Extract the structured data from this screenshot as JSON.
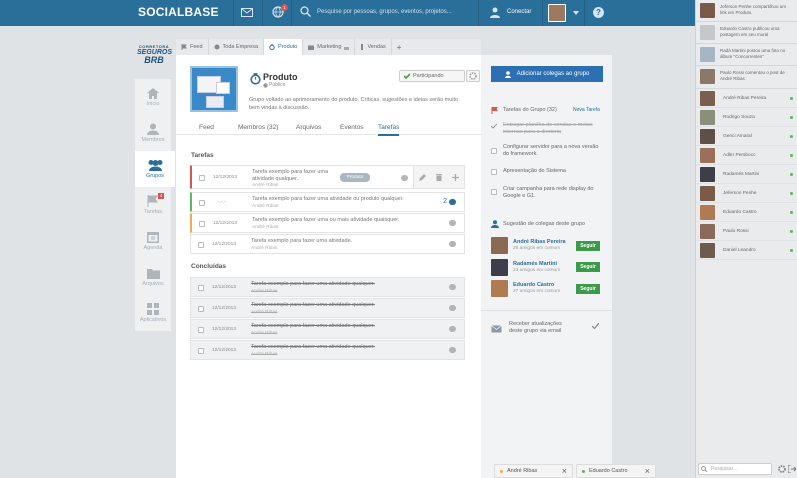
{
  "brand": {
    "logo_text": "SOCIALBASE",
    "company_line1": "CORRETORA",
    "company_line2": "SEGUROS",
    "company_line3": "BRB"
  },
  "topbar": {
    "search_placeholder": "Pesquise por pessoas, grupos, eventos, projetos...",
    "connect_label": "Conectar",
    "notification_count": "1"
  },
  "nav": [
    {
      "label": "Início",
      "icon": "home-icon"
    },
    {
      "label": "Membros",
      "icon": "person-icon"
    },
    {
      "label": "Grupos",
      "icon": "group-icon"
    },
    {
      "label": "Tarefas",
      "icon": "flag-icon",
      "badge": "4"
    },
    {
      "label": "Agenda",
      "icon": "calendar-icon"
    },
    {
      "label": "Arquivos",
      "icon": "folder-icon"
    },
    {
      "label": "Aplicativos",
      "icon": "grid-icon"
    }
  ],
  "tabs": [
    {
      "label": "Feed"
    },
    {
      "label": "Toda Empresa"
    },
    {
      "label": "Produto"
    },
    {
      "label": "Marketing"
    },
    {
      "label": "Vendas"
    },
    {
      "label": "+"
    }
  ],
  "group": {
    "title": "Produto",
    "visibility": "Público",
    "description": "Grupo voltado ao aprimoramento do produto. Críticas, sugestões e ideias serão muito bem vindas à discussão.",
    "participating_label": "Participando"
  },
  "subtabs": [
    {
      "label": "Feed"
    },
    {
      "label": "Membros (32)"
    },
    {
      "label": "Arquivos"
    },
    {
      "label": "Eventos"
    },
    {
      "label": "Tarefas"
    }
  ],
  "tasks_section": "Tarefas",
  "tasks": [
    {
      "date": "12/12/2013",
      "text": "Tarefa exemplo para fazer uma atividade qualquer.",
      "user": "André Ribas",
      "tag": "Produto",
      "color": "#d9534f"
    },
    {
      "date": "-.-.-",
      "text": "Tarefa exemplo para fazer uma atividade ou produto qualquer.",
      "user": "André Ribas",
      "comments": "2",
      "color": "#5cb85c"
    },
    {
      "date": "12/12/2013",
      "text": "Tarefa exemplo para fazer uma ou mais atividade quaisquer.",
      "user": "André Ribas",
      "color": "#f0ad4e"
    },
    {
      "date": "12/12/2013",
      "text": "Tarefa exemplo para fazer uma atividade.",
      "user": "André Ribas",
      "color": ""
    }
  ],
  "done_section": "Concluídas",
  "done_tasks": [
    {
      "date": "12/12/2013",
      "text": "Tarefa exemplo para fazer uma atividade qualquer.",
      "user": "André Ribas"
    },
    {
      "date": "12/12/2013",
      "text": "Tarefa exemplo para fazer uma atividade qualquer.",
      "user": "André Ribas"
    },
    {
      "date": "12/12/2013",
      "text": "Tarefa exemplo para fazer uma atividade qualquer.",
      "user": "André Ribas"
    },
    {
      "date": "12/12/2013",
      "text": "Tarefa exemplo para fazer uma atividade qualquer.",
      "user": "André Ribas"
    }
  ],
  "right": {
    "add_button": "Adicionar colegas ao grupo",
    "group_tasks_title": "Tarefas do Grupo (32)",
    "new_task": "Nova Tarefa",
    "group_tasks": [
      {
        "text": "Entregar planilha de vendas e metas internas para a diretoria",
        "done": true
      },
      {
        "text": "Configurar servidor para a nova versão do framework.",
        "done": false
      },
      {
        "text": "Apresentação do Sistema",
        "done": false
      },
      {
        "text": "Criar campanha para rede display do Google e G1.",
        "done": false
      }
    ],
    "suggest_title": "Sugestão de colegas deste grupo",
    "suggestions": [
      {
        "name": "André Ribas Pereira",
        "sub": "26 amigos em comum",
        "button": "Seguir"
      },
      {
        "name": "Radamés Martini",
        "sub": "23 amigos em comum",
        "button": "Seguir"
      },
      {
        "name": "Eduardo Castro",
        "sub": "27 amigos em comum",
        "button": "Seguir"
      }
    ],
    "updates_text": "Receber atualizações deste grupo via email"
  },
  "chat_tabs": [
    {
      "name": "André Ribas",
      "close": "×",
      "status": "#f0ad4e"
    },
    {
      "name": "Eduardo Castro",
      "close": "×",
      "status": "#5cb85c"
    }
  ],
  "activity": [
    {
      "text": "Jeferson Penhe compartilhou um link em Produto."
    },
    {
      "text": "Eduardo Castro publicou uma postagem em seu mural"
    },
    {
      "text": "Radá Martini postou uma foto no álbum \"Concorrentes\""
    },
    {
      "text": "Paulo Rossi comentou o post de André Ribas"
    }
  ],
  "friends": [
    {
      "name": "André Ribas Pereira"
    },
    {
      "name": "Rodrigo Souza"
    },
    {
      "name": "Gerici Amaral"
    },
    {
      "name": "Adler Persbocc"
    },
    {
      "name": "Radamés Martini"
    },
    {
      "name": "Jeferson Penhe"
    },
    {
      "name": "Eduardo Castro"
    },
    {
      "name": "Paulo Rossi"
    },
    {
      "name": "Daniel Leandro"
    }
  ],
  "friend_search_placeholder": "Pesquisar..."
}
